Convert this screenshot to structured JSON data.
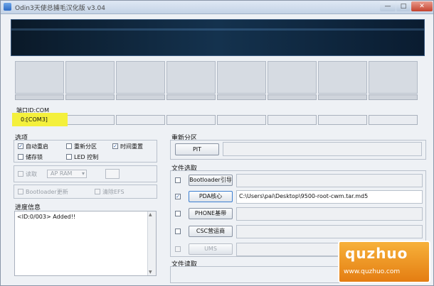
{
  "window": {
    "title": "Odin3天使总捕毛汉化版 v3.04"
  },
  "port": {
    "label": "端口ID:COM",
    "value": "0:[COM3]"
  },
  "options": {
    "heading": "选项",
    "auto_reboot": "自动重启",
    "repartition": "重新分区",
    "reset_time": "时间重置",
    "save_lock": "储存锁",
    "led_control": "LED 控制",
    "read": "读取",
    "ram_select": "AP RAM",
    "bootloader_update": "Bootloader更新",
    "clear_efs": "清除EFS"
  },
  "log": {
    "heading": "进度信息",
    "text": "<ID:0/003> Added!!"
  },
  "repartition": {
    "heading": "重新分区",
    "pit_button": "PIT"
  },
  "files": {
    "heading": "文件选取",
    "bootloader": "Bootloader引导",
    "pda": "PDA核心",
    "pda_path": "C:\\Users\\pai\\Desktop\\9500-root-cwm.tar.md5",
    "phone": "PHONE基带",
    "csc": "CSC营运商",
    "ums": "UMS"
  },
  "file_read": {
    "heading": "文件读取"
  },
  "watermark": {
    "brand": "quzhuo",
    "url": "www.quzhuo.com"
  }
}
